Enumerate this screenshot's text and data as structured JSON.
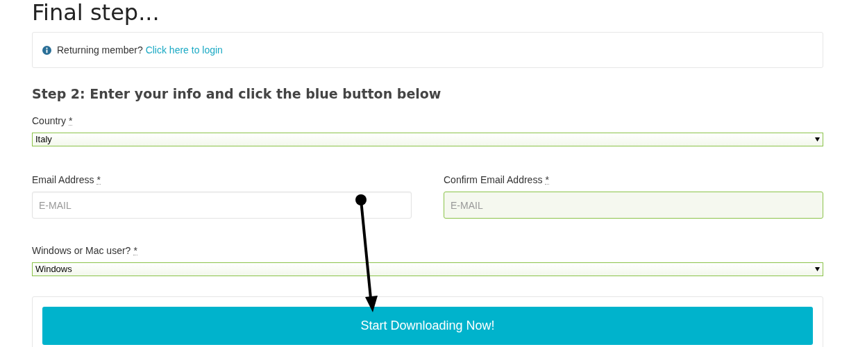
{
  "title": "Final step...",
  "notice": {
    "text": "Returning member?",
    "link": "Click here to login"
  },
  "step_heading": "Step 2: Enter your info and click the blue button below",
  "fields": [
    {
      "kind": "select",
      "label": "Country",
      "required_mark": "*",
      "value": "Italy",
      "validated": true
    },
    {
      "kind": "input",
      "label": "Email Address",
      "required_mark": "*",
      "placeholder": "E-MAIL",
      "validated": false
    },
    {
      "kind": "input",
      "label": "Confirm Email Address",
      "required_mark": "*",
      "placeholder": "E-MAIL",
      "validated": true
    },
    {
      "kind": "select",
      "label": "Windows or Mac user?",
      "required_mark": "*",
      "value": "Windows",
      "validated": true
    }
  ],
  "submit_button": "Start Downloading Now!"
}
